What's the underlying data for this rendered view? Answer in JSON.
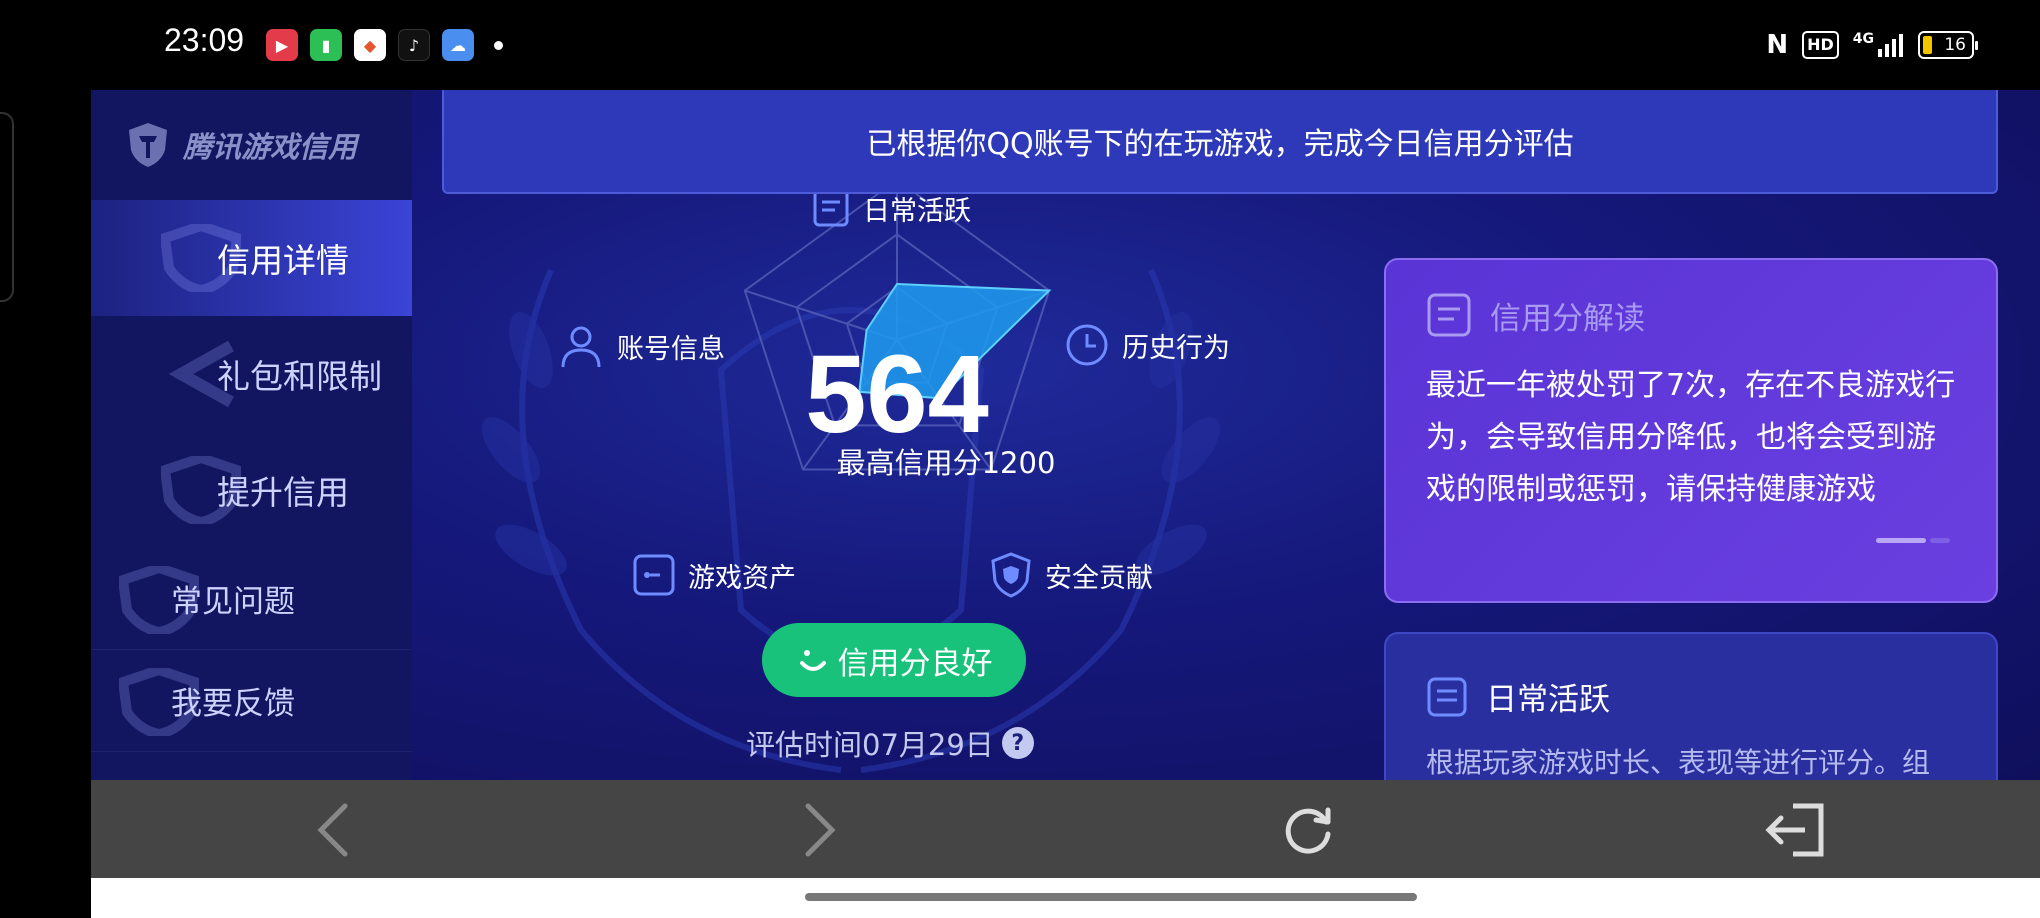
{
  "status_bar": {
    "time": "23:09",
    "network": "4G",
    "hd": "HD",
    "battery": "16",
    "apps": [
      "video-app-icon",
      "battery-saver-app-icon",
      "photo-app-icon",
      "tiktok-icon",
      "weather-icon"
    ]
  },
  "sidebar": {
    "logo_text": "腾讯游戏信用",
    "items": [
      {
        "label": "信用详情",
        "active": true
      },
      {
        "label": "礼包和限制",
        "active": false
      },
      {
        "label": "提升信用",
        "active": false
      },
      {
        "label": "常见问题",
        "active": false
      },
      {
        "label": "我要反馈",
        "active": false
      }
    ]
  },
  "banner": {
    "text": "已根据你QQ账号下的在玩游戏，完成今日信用分评估"
  },
  "radar": {
    "score": "564",
    "max_text": "最高信用分1200",
    "dimensions": [
      "日常活跃",
      "账号信息",
      "历史行为",
      "游戏资产",
      "安全贡献"
    ],
    "status_button": "信用分良好",
    "eval_time": "评估时间07月29日",
    "help": "?"
  },
  "chart_data": {
    "type": "radar",
    "categories": [
      "日常活跃",
      "历史行为",
      "安全贡献",
      "游戏资产",
      "账号信息"
    ],
    "values": [
      0.35,
      1.0,
      0.45,
      0.4,
      0.2
    ],
    "range": [
      0,
      1
    ],
    "fill_color": "#1e9cf0",
    "grid": true
  },
  "cards": {
    "interpretation": {
      "title": "信用分解读",
      "body": "最近一年被处罚了7次，存在不良游戏行为，会导致信用分降低，也将会受到游戏的限制或惩罚，请保持健康游戏"
    },
    "daily": {
      "title": "日常活跃",
      "body": "根据玩家游戏时长、表现等进行评分。组"
    }
  },
  "toolbar": {
    "icons": [
      "back-icon",
      "forward-icon",
      "refresh-icon",
      "exit-icon"
    ]
  },
  "colors": {
    "accent": "#18c27a",
    "card_purple": "#5a34d6",
    "background": "#15187a"
  }
}
